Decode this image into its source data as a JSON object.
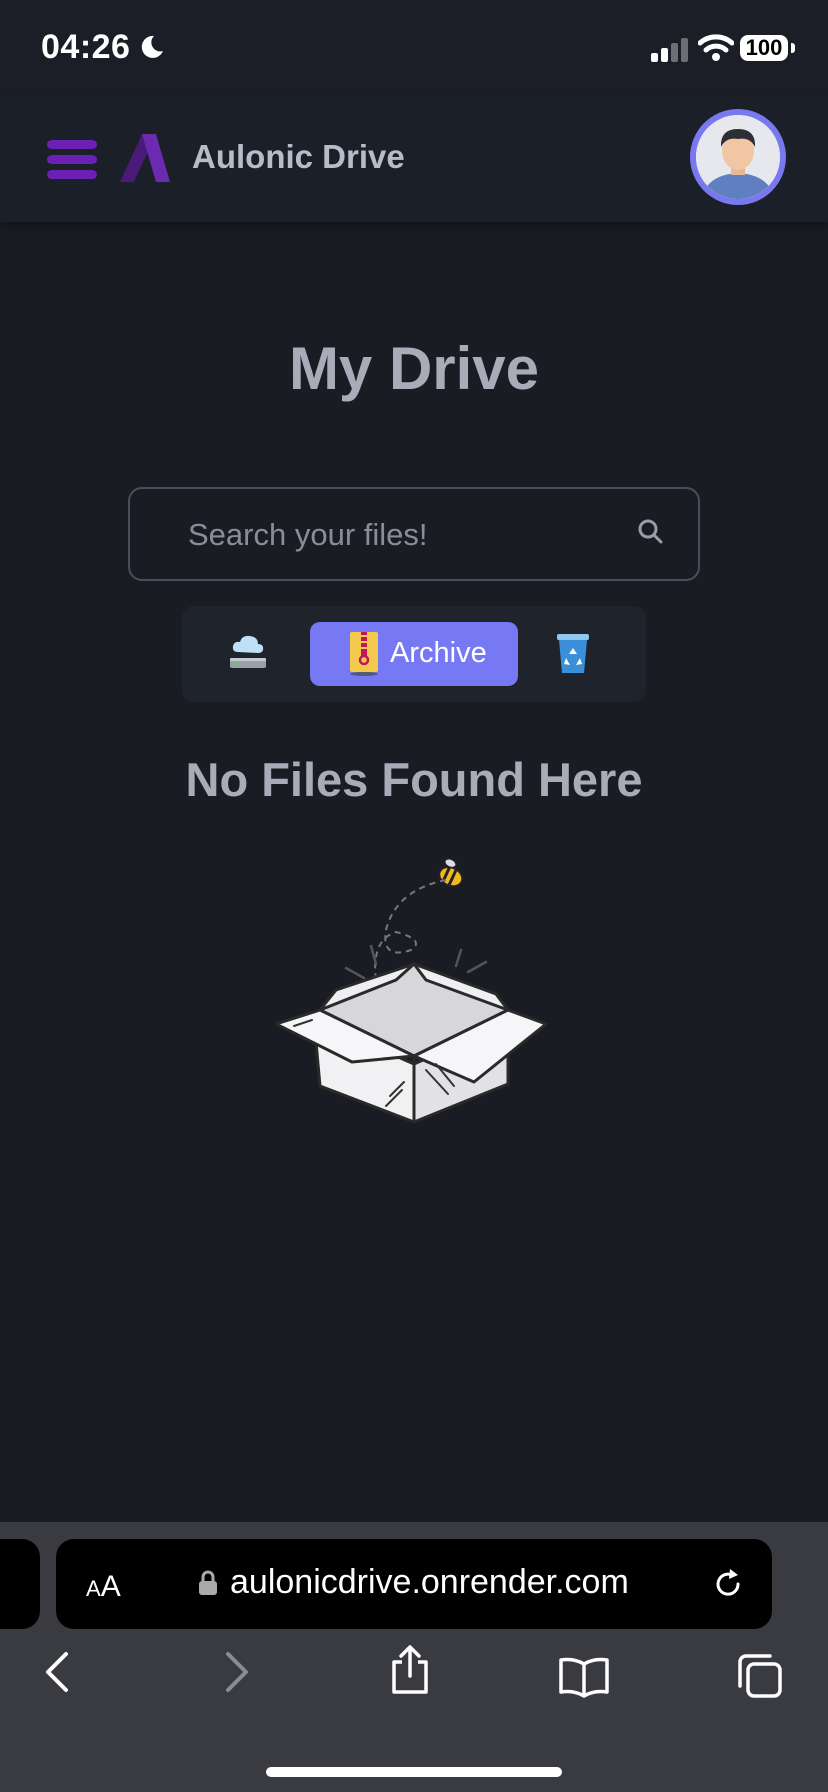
{
  "status": {
    "time": "04:26",
    "battery": "100"
  },
  "header": {
    "brand": "Aulonic Drive",
    "avatar_alt": "User avatar"
  },
  "main": {
    "title": "My Drive",
    "search": {
      "placeholder": "Search your files!",
      "value": ""
    },
    "tabs": [
      {
        "id": "drive",
        "label": "",
        "icon": "cloud-drive-icon"
      },
      {
        "id": "archive",
        "label": "Archive",
        "icon": "zip-archive-icon",
        "active": true
      },
      {
        "id": "trash",
        "label": "",
        "icon": "recycle-bin-icon"
      }
    ],
    "empty_message": "No Files Found Here"
  },
  "browser": {
    "text_size_label": "AA",
    "url": "aulonicdrive.onrender.com"
  },
  "colors": {
    "accent": "#7779f4",
    "menu": "#6b1fb4",
    "background": "#1a1c24",
    "header": "#1b1f27"
  }
}
